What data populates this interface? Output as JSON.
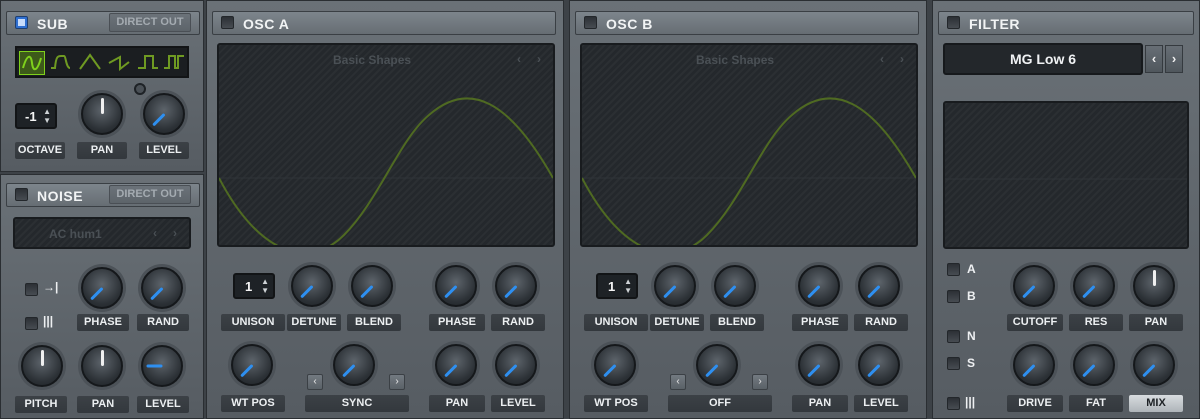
{
  "sub": {
    "title": "SUB",
    "direct_out": "DIRECT OUT",
    "octave_value": "-1",
    "labels": {
      "octave": "OCTAVE",
      "pan": "PAN",
      "level": "LEVEL"
    },
    "waveforms": [
      "sine-wave-icon",
      "round-square-icon",
      "triangle-wave-icon",
      "saw-wave-icon",
      "square-wave-icon",
      "pulse-wave-icon"
    ]
  },
  "noise": {
    "title": "NOISE",
    "direct_out": "DIRECT OUT",
    "preset": "AC hum1",
    "labels": {
      "phase": "PHASE",
      "rand": "RAND",
      "pitch": "PITCH",
      "pan": "PAN",
      "level": "LEVEL"
    }
  },
  "osc_a": {
    "title": "OSC A",
    "preset": "Basic Shapes",
    "unison_value": "1",
    "labels": {
      "unison": "UNISON",
      "detune": "DETUNE",
      "blend": "BLEND",
      "phase": "PHASE",
      "rand": "RAND",
      "wt_pos": "WT POS",
      "sync": "SYNC",
      "pan": "PAN",
      "level": "LEVEL"
    }
  },
  "osc_b": {
    "title": "OSC B",
    "preset": "Basic Shapes",
    "unison_value": "1",
    "labels": {
      "unison": "UNISON",
      "detune": "DETUNE",
      "blend": "BLEND",
      "phase": "PHASE",
      "rand": "RAND",
      "wt_pos": "WT POS",
      "off": "OFF",
      "pan": "PAN",
      "level": "LEVEL"
    }
  },
  "filter": {
    "title": "FILTER",
    "type": "MG Low 6",
    "routing": {
      "a": "A",
      "b": "B",
      "n": "N",
      "s": "S"
    },
    "labels": {
      "cutoff": "CUTOFF",
      "res": "RES",
      "pan": "PAN",
      "drive": "DRIVE",
      "fat": "FAT",
      "mix": "MIX"
    }
  },
  "colors": {
    "accent": "#2e8ff0",
    "wave": "#6f9a22",
    "selected_wave": "#7fd11c",
    "checkbox_on": "#2f6fd1"
  }
}
